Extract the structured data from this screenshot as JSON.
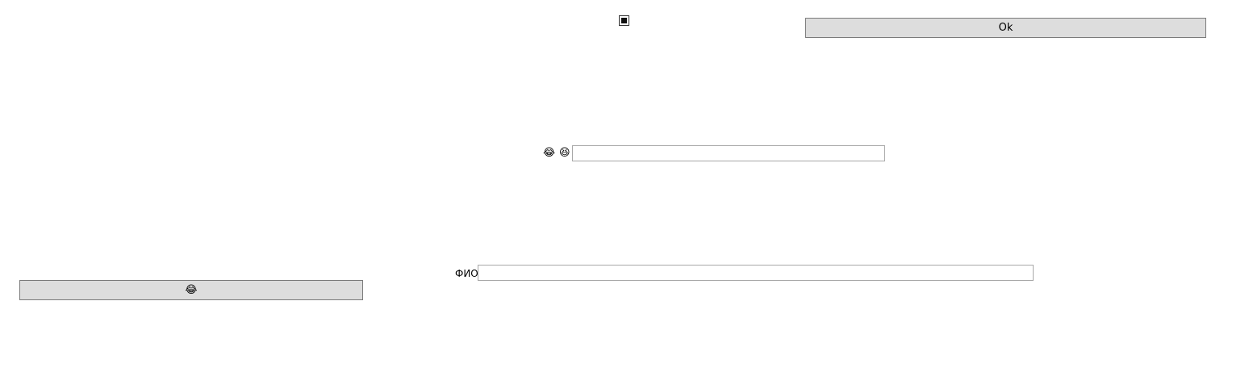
{
  "checkbox": {
    "checked": true
  },
  "ok_button": {
    "label": "Ok"
  },
  "emoji_row": {
    "icon_1": "😂",
    "icon_2": "😆",
    "input_value": ""
  },
  "emoji_button": {
    "label": "😂"
  },
  "fio_field": {
    "label": "ФИО",
    "value": ""
  }
}
